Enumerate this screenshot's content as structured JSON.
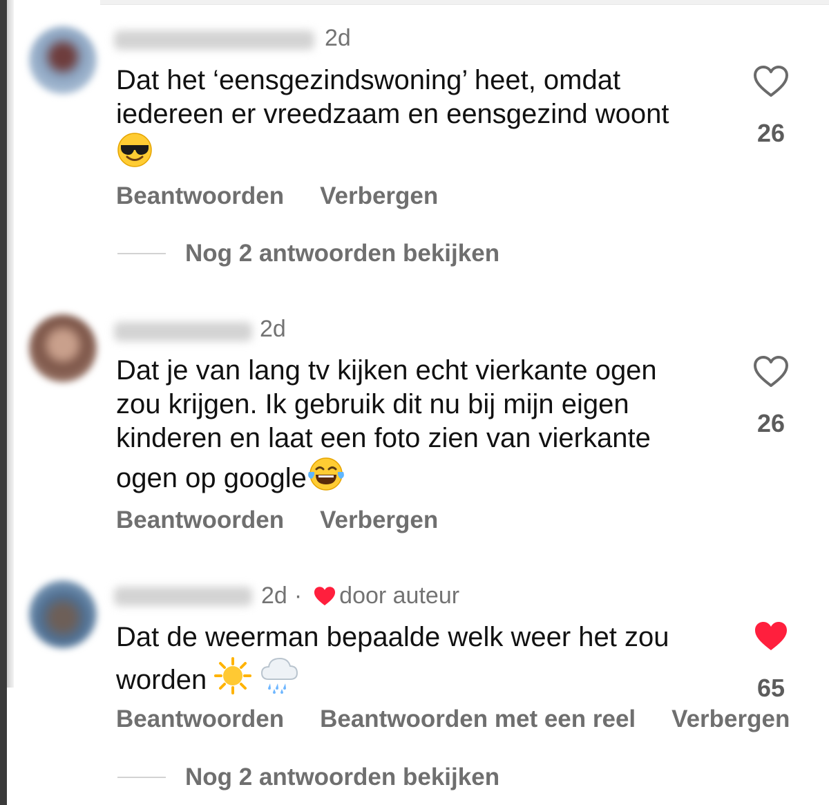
{
  "comments": [
    {
      "time": "2d",
      "text": "Dat het ‘eensgezindswoning’ heet, omdat iedereen er vreedzaam en eensgezind woont",
      "emoji": "smiling-face-with-sunglasses",
      "likes": "26",
      "liked": false,
      "actions": [
        "Beantwoorden",
        "Verbergen"
      ],
      "view_replies": "Nog 2 antwoorden bekijken"
    },
    {
      "time": "2d",
      "text": "Dat je van lang tv kijken echt vierkante ogen zou krijgen. Ik gebruik dit nu bij mijn eigen kinderen en laat een foto zien van vierkante ogen op google",
      "emoji": "face-with-tears-of-joy",
      "likes": "26",
      "liked": false,
      "actions": [
        "Beantwoorden",
        "Verbergen"
      ]
    },
    {
      "time": "2d",
      "separator": "·",
      "author_like": "door auteur",
      "text": "Dat de weerman bepaalde welk weer het zou worden",
      "emojis": [
        "sun",
        "cloud-with-rain"
      ],
      "likes": "65",
      "liked": true,
      "actions": [
        "Beantwoorden",
        "Beantwoorden met een reel",
        "Verbergen"
      ],
      "view_replies": "Nog 2 antwoorden bekijken"
    }
  ],
  "colors": {
    "like_red": "#ff1f3d",
    "secondary_text": "#737373",
    "action_text": "#6f6f6f"
  }
}
